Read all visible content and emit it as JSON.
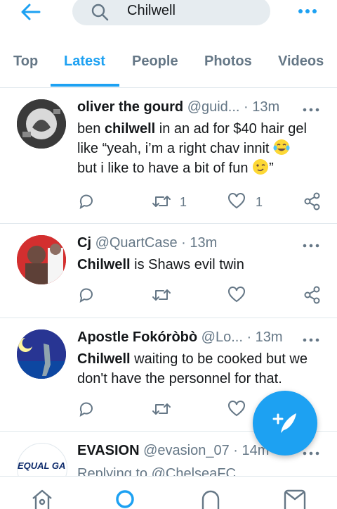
{
  "search": {
    "query": "Chilwell"
  },
  "tabs": [
    {
      "label": "Top"
    },
    {
      "label": "Latest"
    },
    {
      "label": "People"
    },
    {
      "label": "Photos"
    },
    {
      "label": "Videos"
    }
  ],
  "active_tab": "Latest",
  "tweets": [
    {
      "name": "oliver the gourd",
      "handle": "@guid...",
      "time": "· 13m",
      "lines": [
        {
          "pre": "ben ",
          "bold": "chilwell",
          "post": " in an ad for $40 hair gel"
        },
        {
          "pre": "like “yeah, i’m a right chav innit",
          "bold": "",
          "post": ""
        },
        {
          "pre": "but i like to have a bit of fun",
          "bold": "",
          "post": ""
        }
      ],
      "line3_end": "”",
      "retweets": "1",
      "likes": "1"
    },
    {
      "name": "Cj",
      "handle": "@QuartCase",
      "time": "· 13m",
      "bold": "Chilwell",
      "text": " is Shaws evil twin",
      "retweets": "",
      "likes": ""
    },
    {
      "name": "Apostle Fokóròbò",
      "handle": "@Lo...",
      "time": "· 13m",
      "bold": "Chilwell",
      "text": " waiting to be cooked but we",
      "text2": "don't have the personnel for that.",
      "retweets": "",
      "likes": ""
    },
    {
      "name": "EVASION",
      "handle": "@evasion_07",
      "time": "· 14m",
      "avatar_text": "EQUAL GA",
      "reply": "Replying to @ChelseaFC"
    }
  ],
  "colors": {
    "accent": "#1da1f2",
    "secondary": "#657786",
    "divider": "#e1e8ed"
  },
  "icons": [
    "back-arrow-icon",
    "search-icon",
    "more-icon",
    "reply-icon",
    "retweet-icon",
    "like-icon",
    "share-icon",
    "compose-icon",
    "home-icon",
    "explore-icon",
    "notifications-icon",
    "messages-icon"
  ]
}
